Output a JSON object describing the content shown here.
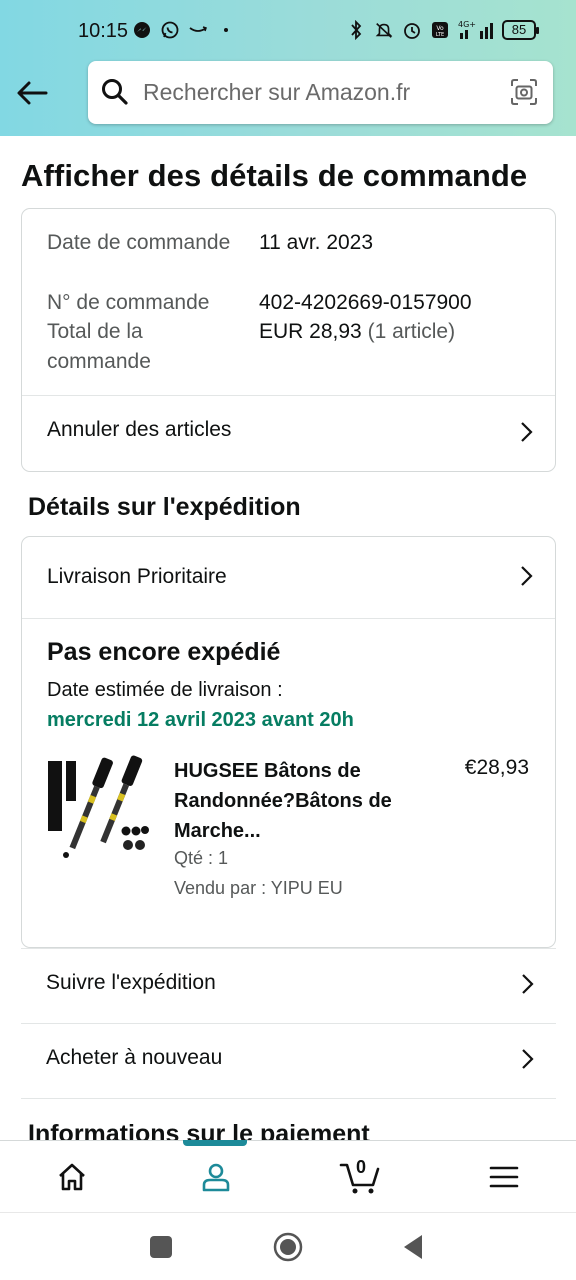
{
  "status_bar": {
    "time": "10:15",
    "battery": "85",
    "network": "4G+",
    "left_icons": [
      "messenger-icon",
      "whatsapp-icon",
      "amazon-smile-icon",
      "dot-icon"
    ],
    "right_icons": [
      "bluetooth-icon",
      "mute-icon",
      "alarm-icon",
      "volte-icon",
      "signal-icon",
      "battery-icon"
    ]
  },
  "search": {
    "placeholder": "Rechercher sur Amazon.fr"
  },
  "page": {
    "title": "Afficher des détails de commande"
  },
  "order_summary": {
    "date_label": "Date de commande",
    "date_value": "11 avr. 2023",
    "number_label": "N° de commande",
    "number_value": "402-4202669-0157900",
    "total_label": "Total de la commande",
    "total_value": "EUR 28,93",
    "total_items": "(1 article)",
    "cancel_label": "Annuler des articles"
  },
  "shipment": {
    "section_title": "Détails sur l'expédition",
    "delivery_option": "Livraison Prioritaire",
    "status": "Pas encore expédié",
    "estimated_label": "Date estimée de livraison :",
    "estimated_date": "mercredi 12 avril 2023 avant 20h",
    "product": {
      "title": "HUGSEE Bâtons de Randonnée?Bâtons de Marche...",
      "price": "€28,93",
      "qty": "Qté : 1",
      "seller": "Vendu par : YIPU EU"
    },
    "track_label": "Suivre l'expédition",
    "buy_again_label": "Acheter à nouveau"
  },
  "payment": {
    "section_title": "Informations sur le paiement"
  },
  "bottom_nav": {
    "items": [
      "home-icon",
      "account-icon",
      "cart-icon",
      "menu-icon"
    ],
    "active": "account-icon",
    "cart_count": "0",
    "accent_color": "#1d8a99"
  },
  "colors": {
    "delivery_green": "#067d62",
    "header_gradient_start": "#82d8e3",
    "header_gradient_end": "#a6e3cf"
  }
}
